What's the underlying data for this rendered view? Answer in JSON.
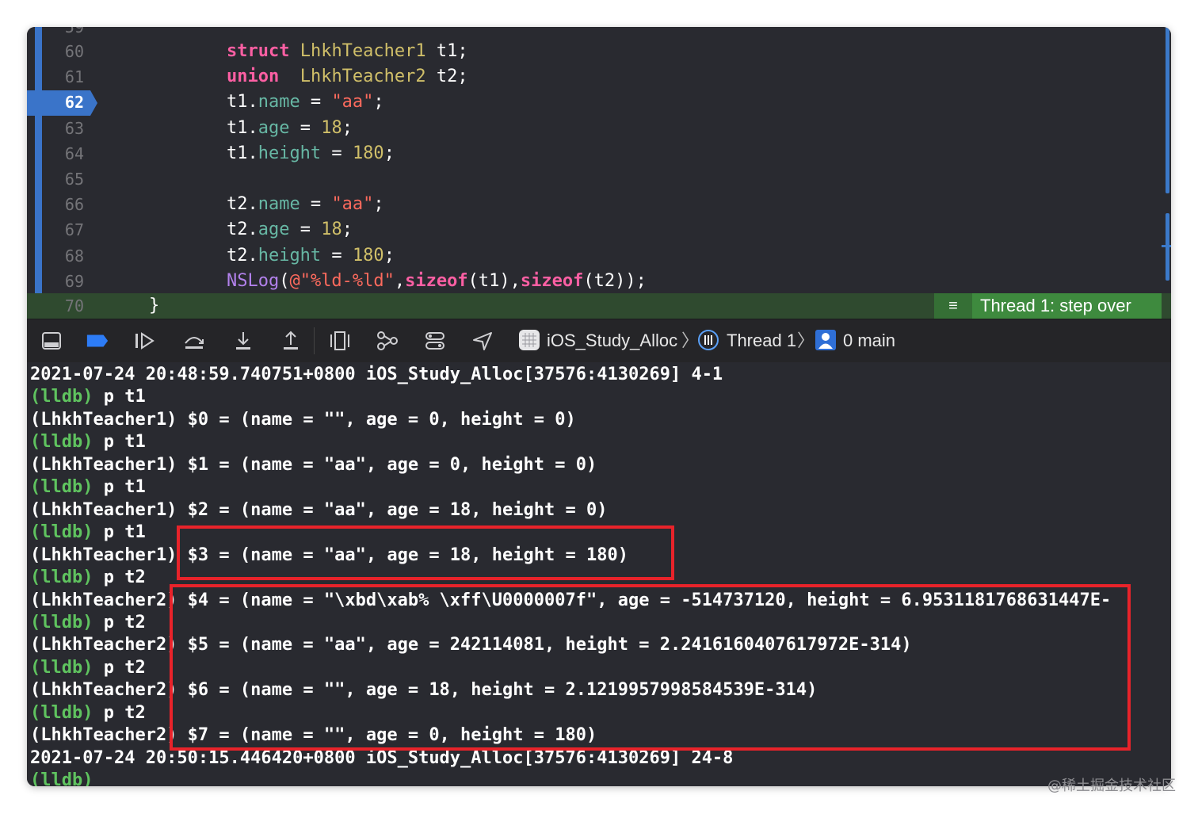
{
  "editor": {
    "partial_line_number": "59",
    "lines": [
      {
        "num": "60",
        "tokens": [
          {
            "t": "        "
          },
          {
            "t": "struct",
            "c": "kw"
          },
          {
            "t": " "
          },
          {
            "t": "LhkhTeacher1",
            "c": "ty"
          },
          {
            "t": " t1;"
          }
        ]
      },
      {
        "num": "61",
        "tokens": [
          {
            "t": "        "
          },
          {
            "t": "union",
            "c": "kw"
          },
          {
            "t": "  "
          },
          {
            "t": "LhkhTeacher2",
            "c": "ty"
          },
          {
            "t": " t2;"
          }
        ]
      },
      {
        "num": "62",
        "tokens": [
          {
            "t": "        t1."
          },
          {
            "t": "name",
            "c": "prop"
          },
          {
            "t": " = "
          },
          {
            "t": "\"aa\"",
            "c": "str"
          },
          {
            "t": ";"
          }
        ]
      },
      {
        "num": "63",
        "tokens": [
          {
            "t": "        t1."
          },
          {
            "t": "age",
            "c": "prop"
          },
          {
            "t": " = "
          },
          {
            "t": "18",
            "c": "num"
          },
          {
            "t": ";"
          }
        ]
      },
      {
        "num": "64",
        "tokens": [
          {
            "t": "        t1."
          },
          {
            "t": "height",
            "c": "prop"
          },
          {
            "t": " = "
          },
          {
            "t": "180",
            "c": "num"
          },
          {
            "t": ";"
          }
        ]
      },
      {
        "num": "65",
        "tokens": []
      },
      {
        "num": "66",
        "tokens": [
          {
            "t": "        t2."
          },
          {
            "t": "name",
            "c": "prop"
          },
          {
            "t": " = "
          },
          {
            "t": "\"aa\"",
            "c": "str"
          },
          {
            "t": ";"
          }
        ]
      },
      {
        "num": "67",
        "tokens": [
          {
            "t": "        t2."
          },
          {
            "t": "age",
            "c": "prop"
          },
          {
            "t": " = "
          },
          {
            "t": "18",
            "c": "num"
          },
          {
            "t": ";"
          }
        ]
      },
      {
        "num": "68",
        "tokens": [
          {
            "t": "        t2."
          },
          {
            "t": "height",
            "c": "prop"
          },
          {
            "t": " = "
          },
          {
            "t": "180",
            "c": "num"
          },
          {
            "t": ";"
          }
        ]
      },
      {
        "num": "69",
        "tokens": [
          {
            "t": "        "
          },
          {
            "t": "NSLog",
            "c": "fn"
          },
          {
            "t": "("
          },
          {
            "t": "@\"%ld-%ld\"",
            "c": "str"
          },
          {
            "t": ","
          },
          {
            "t": "sizeof",
            "c": "kw"
          },
          {
            "t": "(t1),"
          },
          {
            "t": "sizeof",
            "c": "kw"
          },
          {
            "t": "(t2));"
          }
        ]
      }
    ],
    "active_line": "62",
    "last_line": {
      "num": "70",
      "text": "}"
    },
    "thread_badge": "Thread 1: step over"
  },
  "toolbar": {
    "icons": [
      "console-toggle-icon",
      "breakpoint-toggle-icon",
      "continue-icon",
      "step-over-icon",
      "step-into-icon",
      "step-out-icon",
      "view-hierarchy-icon",
      "memory-graph-icon",
      "environment-overrides-icon",
      "simulate-location-icon"
    ],
    "breadcrumb": {
      "app": "iOS_Study_Alloc",
      "thread": "Thread 1",
      "frame": "0 main"
    }
  },
  "console": {
    "lines": [
      {
        "text": "2021-07-24 20:48:59.740751+0800 iOS_Study_Alloc[37576:4130269] 4-1"
      },
      {
        "prompt": "(lldb)",
        "text": " p t1"
      },
      {
        "text": "(LhkhTeacher1) $0 = (name = \"\", age = 0, height = 0)"
      },
      {
        "prompt": "(lldb)",
        "text": " p t1"
      },
      {
        "text": "(LhkhTeacher1) $1 = (name = \"aa\", age = 0, height = 0)"
      },
      {
        "prompt": "(lldb)",
        "text": " p t1"
      },
      {
        "text": "(LhkhTeacher1) $2 = (name = \"aa\", age = 18, height = 0)"
      },
      {
        "prompt": "(lldb)",
        "text": " p t1"
      },
      {
        "text": "(LhkhTeacher1) $3 = (name = \"aa\", age = 18, height = 180)"
      },
      {
        "prompt": "(lldb)",
        "text": " p t2"
      },
      {
        "text": "(LhkhTeacher2) $4 = (name = \"\\xbd\\xab% \\xff\\U0000007f\", age = -514737120, height = 6.9531181768631447E-"
      },
      {
        "prompt": "(lldb)",
        "text": " p t2"
      },
      {
        "text": "(LhkhTeacher2) $5 = (name = \"aa\", age = 242114081, height = 2.2416160407617972E-314)"
      },
      {
        "prompt": "(lldb)",
        "text": " p t2"
      },
      {
        "text": "(LhkhTeacher2) $6 = (name = \"\", age = 18, height = 2.1219957998584539E-314)"
      },
      {
        "prompt": "(lldb)",
        "text": " p t2"
      },
      {
        "text": "(LhkhTeacher2) $7 = (name = \"\", age = 0, height = 180)"
      },
      {
        "text": "2021-07-24 20:50:15.446420+0800 iOS_Study_Alloc[37576:4130269] 24-8"
      },
      {
        "prompt": "(lldb)",
        "text": ""
      }
    ]
  },
  "watermark": "@稀土掘金技术社区",
  "colors": {
    "keyword": "#fc5fa3",
    "type": "#d0bf69",
    "property": "#67b7a4",
    "string": "#fc6a5d",
    "function": "#b281eb",
    "prompt": "#5fc35f",
    "highlight_box": "#e8232a",
    "breakpoint": "#3a74c9",
    "thread_badge": "#3e8a3e"
  }
}
